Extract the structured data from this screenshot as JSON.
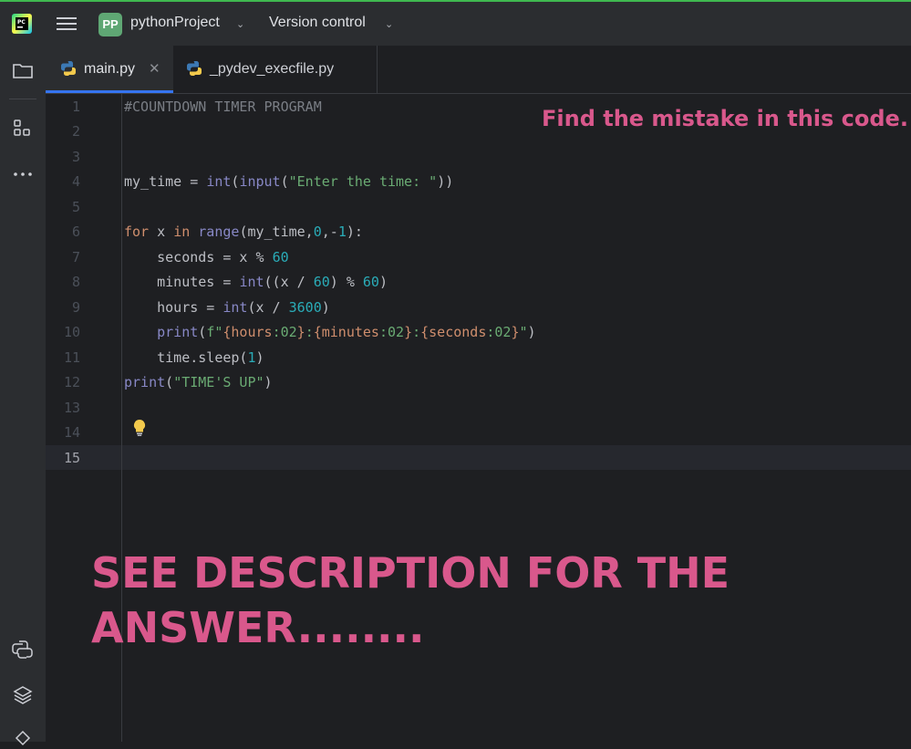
{
  "titlebar": {
    "project_badge": "PP",
    "project_name": "pythonProject",
    "version_control": "Version control"
  },
  "tabs": [
    {
      "label": "main.py",
      "active": true
    },
    {
      "label": "_pydev_execfile.py",
      "active": false
    }
  ],
  "editor": {
    "current_line": 15,
    "lines": [
      {
        "n": "1"
      },
      {
        "n": "2"
      },
      {
        "n": "3"
      },
      {
        "n": "4"
      },
      {
        "n": "5"
      },
      {
        "n": "6"
      },
      {
        "n": "7"
      },
      {
        "n": "8"
      },
      {
        "n": "9"
      },
      {
        "n": "10"
      },
      {
        "n": "11"
      },
      {
        "n": "12"
      },
      {
        "n": "13"
      },
      {
        "n": "14"
      },
      {
        "n": "15"
      }
    ],
    "tokens": {
      "l1": "#COUNTDOWN TIMER PROGRAM",
      "l4_a": "my_time = ",
      "l4_int": "int",
      "l4_b": "(",
      "l4_input": "input",
      "l4_c": "(",
      "l4_str": "\"Enter the time: \"",
      "l4_d": "))",
      "l6_for": "for",
      "l6_a": " x ",
      "l6_in": "in",
      "l6_b": " ",
      "l6_range": "range",
      "l6_c": "(my_time,",
      "l6_0": "0",
      "l6_d": ",-",
      "l6_1": "1",
      "l6_e": "):",
      "l7_a": "    seconds = x % ",
      "l7_60": "60",
      "l8_a": "    minutes = ",
      "l8_int": "int",
      "l8_b": "((x / ",
      "l8_60a": "60",
      "l8_c": ") % ",
      "l8_60b": "60",
      "l8_d": ")",
      "l9_a": "    hours = ",
      "l9_int": "int",
      "l9_b": "(x / ",
      "l9_3600": "3600",
      "l9_c": ")",
      "l10_a": "    ",
      "l10_print": "print",
      "l10_b": "(",
      "l10_f": "f\"",
      "l10_c": "{hours",
      "l10_02a": ":02",
      "l10_d": "}",
      "l10_colon1": ":",
      "l10_e": "{minutes",
      "l10_02b": ":02",
      "l10_f2": "}",
      "l10_colon2": ":",
      "l10_g": "{seconds",
      "l10_02c": ":02",
      "l10_h": "}",
      "l10_q": "\"",
      "l10_i": ")",
      "l11_a": "    time.sleep(",
      "l11_1": "1",
      "l11_b": ")",
      "l12_print": "print",
      "l12_a": "(",
      "l12_str": "\"TIME'S UP\"",
      "l12_b": ")"
    }
  },
  "annotations": {
    "note": "Find the mistake in this code.",
    "answer": "SEE DESCRIPTION FOR THE ANSWER........"
  },
  "colors": {
    "accent": "#3574f0",
    "overlay_text": "#d9588c",
    "keyword": "#cf8e6d",
    "string": "#6aab73",
    "number": "#2aacb8",
    "builtin": "#8888c6",
    "comment": "#7a7e85"
  },
  "icons": {
    "app": "pycharm-logo-icon",
    "menu": "hamburger-menu-icon",
    "project": "folder-icon",
    "structure": "structure-icon",
    "more": "more-horizontal-icon",
    "python_console": "python-icon",
    "layers": "layers-icon",
    "bulb": "lightbulb-icon"
  }
}
